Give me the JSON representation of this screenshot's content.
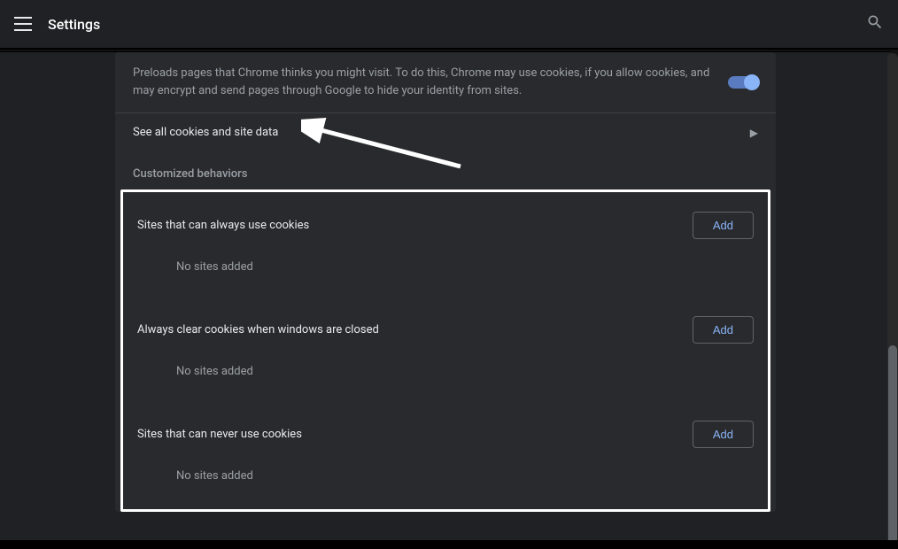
{
  "header": {
    "title": "Settings"
  },
  "preload": {
    "text": "Preloads pages that Chrome thinks you might visit. To do this, Chrome may use cookies, if you allow cookies, and may encrypt and send pages through Google to hide your identity from sites.",
    "toggle_on": true
  },
  "cookies_link": {
    "label": "See all cookies and site data"
  },
  "section_label": "Customized behaviors",
  "sites": [
    {
      "title": "Sites that can always use cookies",
      "add": "Add",
      "empty": "No sites added"
    },
    {
      "title": "Always clear cookies when windows are closed",
      "add": "Add",
      "empty": "No sites added"
    },
    {
      "title": "Sites that can never use cookies",
      "add": "Add",
      "empty": "No sites added"
    }
  ]
}
